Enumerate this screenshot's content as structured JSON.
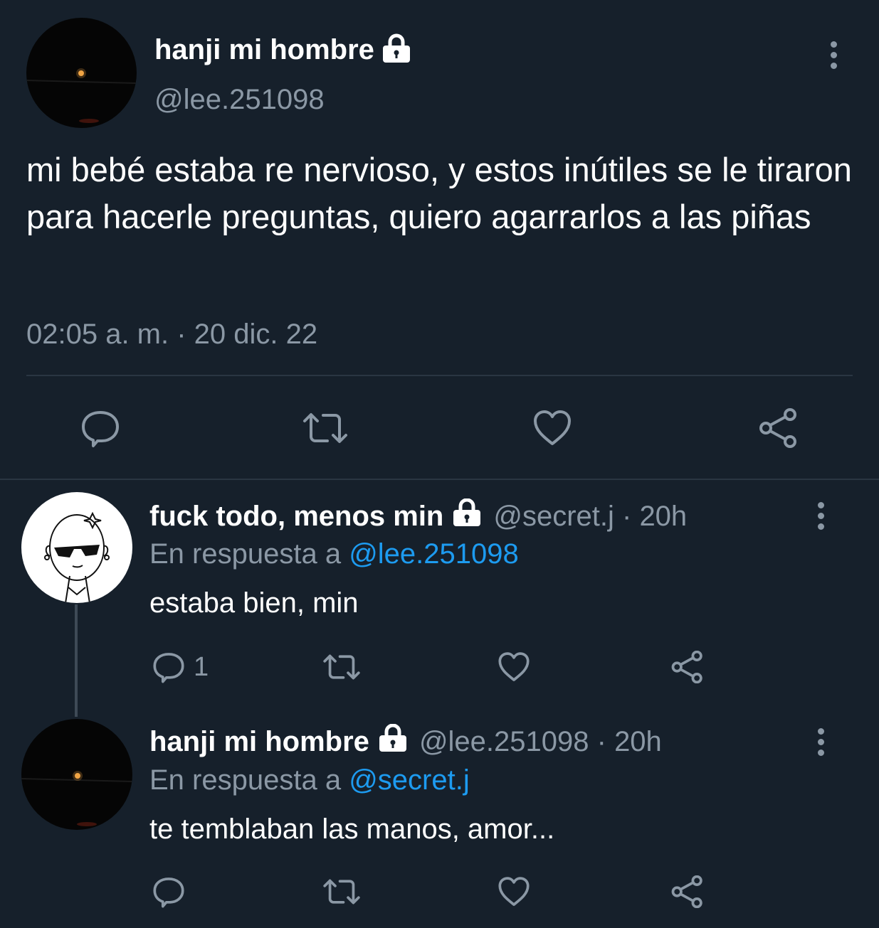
{
  "main_tweet": {
    "name": "hanji mi hombre",
    "handle": "@lee.251098",
    "text": "mi bebé estaba re nervioso, y estos inútiles se le tiraron para hacerle preguntas, quiero agarrarlos a las piñas",
    "timestamp": "02:05 a. m. · 20 dic. 22"
  },
  "replies": [
    {
      "name": "fuck todo, menos min",
      "handle": "@secret.j",
      "separator": " · ",
      "time": "20h",
      "reply_prefix": "En respuesta a",
      "reply_to": "@lee.251098",
      "text": "estaba bien, min",
      "reply_count": "1"
    },
    {
      "name": "hanji mi hombre",
      "handle": "@lee.251098",
      "separator": " · ",
      "time": "20h",
      "reply_prefix": "En respuesta a",
      "reply_to": "@secret.j",
      "text": "te temblaban las manos, amor...",
      "reply_count": ""
    }
  ],
  "icons": [
    "lock-icon",
    "more-icon",
    "reply-icon",
    "retweet-icon",
    "like-icon",
    "share-icon"
  ],
  "colors": {
    "background": "#16202b",
    "accent": "#1d9bf0",
    "muted": "#8b98a5"
  }
}
